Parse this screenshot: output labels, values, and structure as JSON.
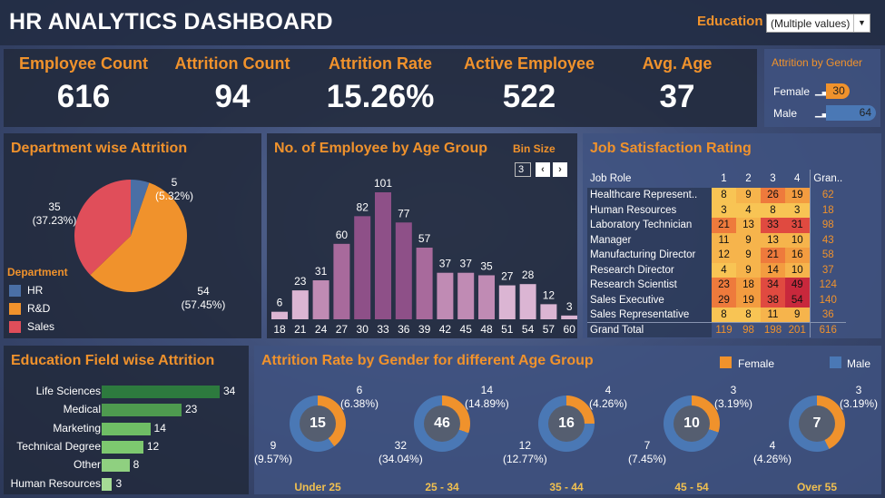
{
  "header": {
    "title": "HR ANALYTICS DASHBOARD",
    "education_label": "Education",
    "education_value": "(Multiple values)"
  },
  "kpis": [
    {
      "label": "Employee Count",
      "value": "616"
    },
    {
      "label": "Attrition Count",
      "value": "94"
    },
    {
      "label": "Attrition Rate",
      "value": "15.26%"
    },
    {
      "label": "Active Employee",
      "value": "522"
    },
    {
      "label": "Avg. Age",
      "value": "37"
    }
  ],
  "gender_attrition": {
    "title": "Attrition by Gender",
    "female_label": "Female",
    "female_value": "30",
    "male_label": "Male",
    "male_value": "64",
    "female_color": "#f0922c",
    "male_color": "#4a78b5"
  },
  "department": {
    "title": "Department wise Attrition",
    "legend_title": "Department",
    "items": [
      {
        "name": "HR",
        "count": "5",
        "pct": "(5.32%)",
        "value": 5.32,
        "color": "#4a6fa5"
      },
      {
        "name": "R&D",
        "count": "54",
        "pct": "(57.45%)",
        "value": 57.45,
        "color": "#f0922c"
      },
      {
        "name": "Sales",
        "count": "35",
        "pct": "(37.23%)",
        "value": 37.23,
        "color": "#e04e5a"
      }
    ]
  },
  "age_group": {
    "title": "No. of Employee by Age Group",
    "bin_label": "Bin Size",
    "bin_value": "3",
    "prev_icon": "‹",
    "next_icon": "›"
  },
  "chart_data": {
    "type": "bar",
    "categories": [
      "18",
      "21",
      "24",
      "27",
      "30",
      "33",
      "36",
      "39",
      "42",
      "45",
      "48",
      "51",
      "54",
      "57",
      "60"
    ],
    "values": [
      6,
      23,
      31,
      60,
      82,
      101,
      77,
      57,
      37,
      37,
      35,
      27,
      28,
      12,
      3
    ],
    "ylim": [
      0,
      101
    ]
  },
  "job_satisfaction": {
    "title": "Job Satisfaction Rating",
    "headers": [
      "Job Role",
      "1",
      "2",
      "3",
      "4",
      "Gran.."
    ],
    "rows": [
      {
        "role": "Healthcare Represent..",
        "v": [
          "8",
          "9",
          "26",
          "19"
        ],
        "total": "62"
      },
      {
        "role": "Human Resources",
        "v": [
          "3",
          "4",
          "8",
          "3"
        ],
        "total": "18"
      },
      {
        "role": "Laboratory Technician",
        "v": [
          "21",
          "13",
          "33",
          "31"
        ],
        "total": "98"
      },
      {
        "role": "Manager",
        "v": [
          "11",
          "9",
          "13",
          "10"
        ],
        "total": "43"
      },
      {
        "role": "Manufacturing Director",
        "v": [
          "12",
          "9",
          "21",
          "16"
        ],
        "total": "58"
      },
      {
        "role": "Research Director",
        "v": [
          "4",
          "9",
          "14",
          "10"
        ],
        "total": "37"
      },
      {
        "role": "Research Scientist",
        "v": [
          "23",
          "18",
          "34",
          "49"
        ],
        "total": "124"
      },
      {
        "role": "Sales Executive",
        "v": [
          "29",
          "19",
          "38",
          "54"
        ],
        "total": "140"
      },
      {
        "role": "Sales Representative",
        "v": [
          "8",
          "8",
          "11",
          "9"
        ],
        "total": "36"
      }
    ],
    "grand_total": {
      "label": "Grand Total",
      "v": [
        "119",
        "98",
        "198",
        "201"
      ],
      "total": "616"
    }
  },
  "education_field": {
    "title": "Education Field wise Attrition",
    "items": [
      {
        "label": "Life Sciences",
        "value": 34,
        "text": "34",
        "color": "#2d7a3e"
      },
      {
        "label": "Medical",
        "value": 23,
        "text": "23",
        "color": "#4e9a4f"
      },
      {
        "label": "Marketing",
        "value": 14,
        "text": "14",
        "color": "#6fbe65"
      },
      {
        "label": "Technical Degree",
        "value": 12,
        "text": "12",
        "color": "#7dc86f"
      },
      {
        "label": "Other",
        "value": 8,
        "text": "8",
        "color": "#8fd080"
      },
      {
        "label": "Human Resources",
        "value": 3,
        "text": "3",
        "color": "#a5dc95"
      }
    ]
  },
  "gender_age": {
    "title": "Attrition Rate by Gender for different Age Group",
    "legend_female": "Female",
    "legend_male": "Male",
    "female_color": "#f0922c",
    "male_color": "#4a78b5",
    "groups": [
      {
        "label": "Under 25",
        "total": "15",
        "female": "6",
        "female_pct": "(6.38%)",
        "male": "9",
        "male_pct": "(9.57%)",
        "female_share": 40
      },
      {
        "label": "25 - 34",
        "total": "46",
        "female": "14",
        "female_pct": "(14.89%)",
        "male": "32",
        "male_pct": "(34.04%)",
        "female_share": 30.4
      },
      {
        "label": "35 - 44",
        "total": "16",
        "female": "4",
        "female_pct": "(4.26%)",
        "male": "12",
        "male_pct": "(12.77%)",
        "female_share": 25
      },
      {
        "label": "45 - 54",
        "total": "10",
        "female": "3",
        "female_pct": "(3.19%)",
        "male": "7",
        "male_pct": "(7.45%)",
        "female_share": 30
      },
      {
        "label": "Over 55",
        "total": "7",
        "female": "3",
        "female_pct": "(3.19%)",
        "male": "4",
        "male_pct": "(4.26%)",
        "female_share": 42.9
      }
    ]
  }
}
